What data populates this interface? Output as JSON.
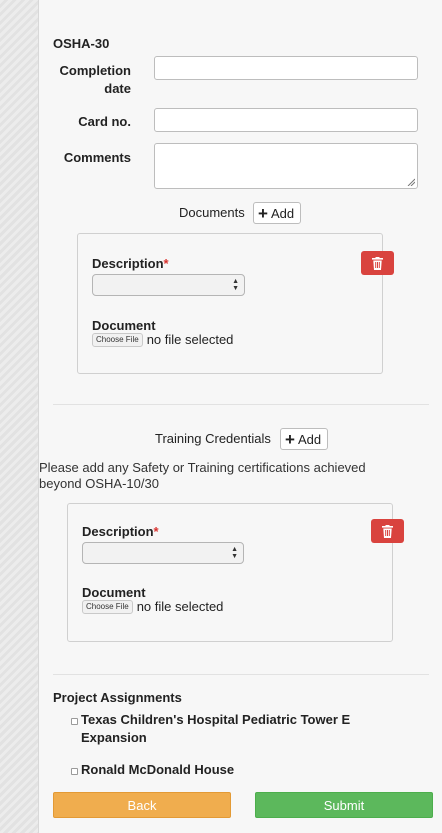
{
  "osha": {
    "heading": "OSHA-30",
    "completion_label": "Completion date",
    "card_label": "Card no.",
    "comments_label": "Comments",
    "completion_value": "",
    "card_value": "",
    "comments_value": ""
  },
  "documents": {
    "label": "Documents",
    "add_label": "Add",
    "card": {
      "description_label": "Description",
      "required_mark": "*",
      "selected_value": "",
      "document_label": "Document",
      "choose_file_label": "Choose File",
      "file_status": "no file selected"
    }
  },
  "training": {
    "label": "Training Credentials",
    "add_label": "Add",
    "help_text": "Please add any Safety or Training certifications achieved beyond OSHA-10/30",
    "card": {
      "description_label": "Description",
      "required_mark": "*",
      "selected_value": "",
      "document_label": "Document",
      "choose_file_label": "Choose File",
      "file_status": "no file selected"
    }
  },
  "projects": {
    "heading": "Project Assignments",
    "items": [
      {
        "label": "Texas Children's Hospital Pediatric Tower E Expansion",
        "checked": false
      },
      {
        "label": "Ronald McDonald House",
        "checked": false
      }
    ]
  },
  "actions": {
    "back_label": "Back",
    "submit_label": "Submit"
  },
  "colors": {
    "back": "#f0ad4e",
    "submit": "#5cb85c",
    "delete": "#d9433e",
    "required": "#d9322e"
  }
}
